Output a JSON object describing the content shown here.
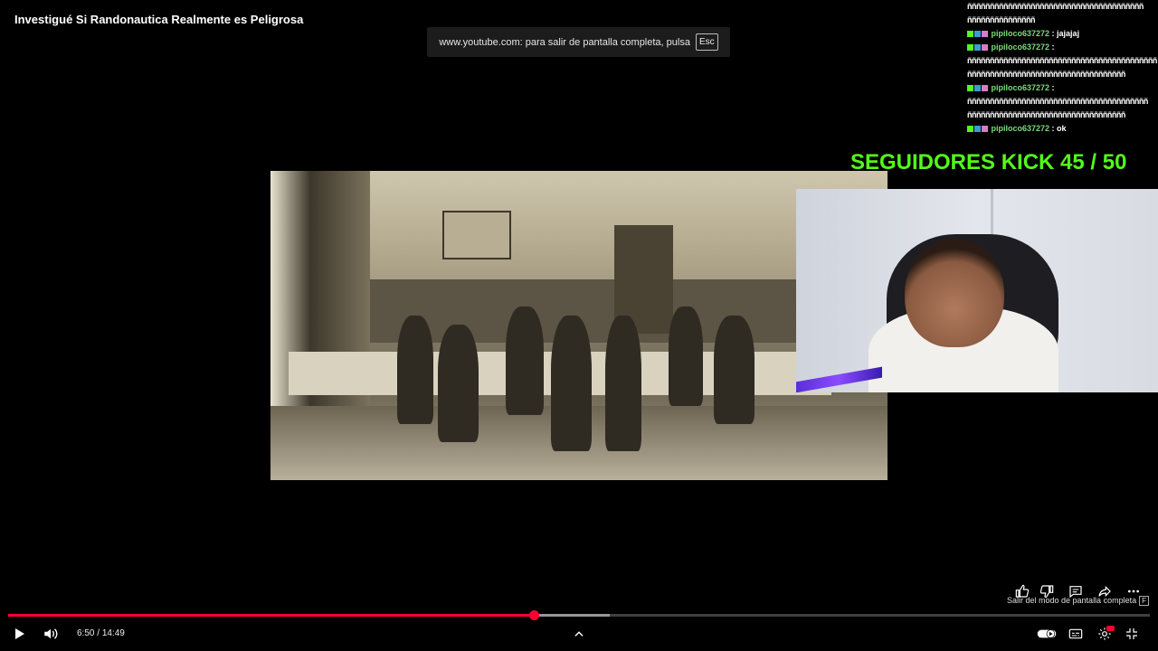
{
  "video": {
    "title": "Investigué Si Randonautica Realmente es Peligrosa"
  },
  "fullscreen_notice": {
    "text": "www.youtube.com: para salir de pantalla completa, pulsa",
    "key": "Esc"
  },
  "chat": {
    "garble_1": "ñññññññññññññññññññññññññññññññññññññññ",
    "garble_2": "ñññññññññññññññ",
    "messages": [
      {
        "user": "pipiloco637272",
        "sep": " : ",
        "text": "jajajaj"
      },
      {
        "user": "pipiloco637272",
        "sep": " :",
        "text": ""
      },
      {
        "user": "pipiloco637272",
        "sep": " :",
        "text": ""
      },
      {
        "user": "pipiloco637272",
        "sep": " : ",
        "text": "ok"
      }
    ],
    "garble_3": "ññññññññññññññññññññññññññññññññññññññññññ",
    "garble_4": "ñññññññññññññññññññññññññññññññññññ",
    "garble_5": "ññññññññññññññññññññññññññññññññññññññññ",
    "garble_6": "ñññññññññññññññññññññññññññññññññññ"
  },
  "overlay": {
    "followers": "SEGUIDORES KICK 45 / 50"
  },
  "player": {
    "current_time": "6:50",
    "separator": " / ",
    "duration": "14:49",
    "progress_fraction": 0.461,
    "buffer_fraction": 0.527,
    "exit_fullscreen_hint": "Salir del modo de pantalla completa",
    "exit_fullscreen_key": "F"
  },
  "icons": {
    "play": "play-icon",
    "volume": "volume-icon",
    "chevron": "chevron-up-icon",
    "like": "thumbs-up-icon",
    "dislike": "thumbs-down-icon",
    "comments": "comment-icon",
    "share": "share-icon",
    "more": "more-icon",
    "autoplay": "autoplay-toggle-icon",
    "captions": "captions-icon",
    "settings": "settings-icon",
    "exit_fullscreen": "exit-fullscreen-icon"
  },
  "colors": {
    "progress": "#ff0033",
    "followers": "#53fc18",
    "chat_user": "#7dd97d"
  }
}
